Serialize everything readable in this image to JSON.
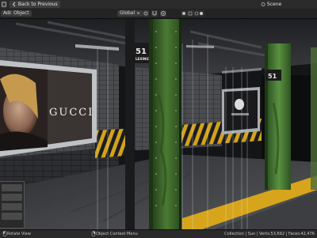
{
  "topbar": {
    "back_label": "Back to Previous",
    "scene_label": "Scene"
  },
  "header2": {
    "add_label": "Add",
    "object_label": "Object",
    "orientation_label": "Global"
  },
  "viewport": {
    "poster_brand": "GUCCI",
    "sign_main": "51",
    "sign_sub": "LEXINGTON",
    "sign_right": "51"
  },
  "statusbar": {
    "left": "Rotate View",
    "middle": "Object Context Menu",
    "right": "Collection | Sun | Verts:53,692 | Faces:42,476"
  },
  "colors": {
    "ui_dark": "#2b2b2b",
    "column_green": "#3e6a2a",
    "safety_yellow": "#d7a51b",
    "tile_gray": "#4d4f52"
  }
}
